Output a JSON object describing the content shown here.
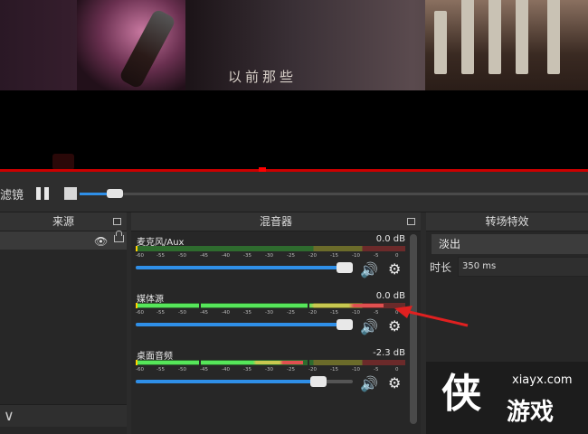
{
  "preview": {
    "subtitle": "以前那些"
  },
  "controls": {
    "left_label": "滤镜",
    "seek_fraction": 0.07
  },
  "sources": {
    "title": "来源"
  },
  "mixer": {
    "title": "混音器",
    "channels": [
      {
        "name": "麦克风/Aux",
        "db": "0.0 dB",
        "volume_fraction": 1.0,
        "level_fraction": 0.0
      },
      {
        "name": "媒体源",
        "db": "0.0 dB",
        "volume_fraction": 1.0,
        "level_fraction": 0.92
      },
      {
        "name": "桌面音频",
        "db": "-2.3 dB",
        "volume_fraction": 0.88,
        "level_fraction": 0.62
      }
    ],
    "ticks": [
      "-60",
      "-55",
      "-50",
      "-45",
      "-40",
      "-35",
      "-30",
      "-25",
      "-20",
      "-15",
      "-10",
      "-5",
      "0"
    ]
  },
  "transitions": {
    "title": "转场特效",
    "selected": "淡出",
    "duration_label": "时长",
    "duration_value": "350 ms"
  },
  "watermark": {
    "url": "xiayx.com",
    "logo": "侠",
    "cn": "游戏"
  },
  "icons": {
    "eye": "eye-icon",
    "lock": "lock-icon",
    "speaker": "speaker-icon",
    "gear": "gear-icon",
    "pause": "pause-icon",
    "stop": "stop-icon"
  }
}
